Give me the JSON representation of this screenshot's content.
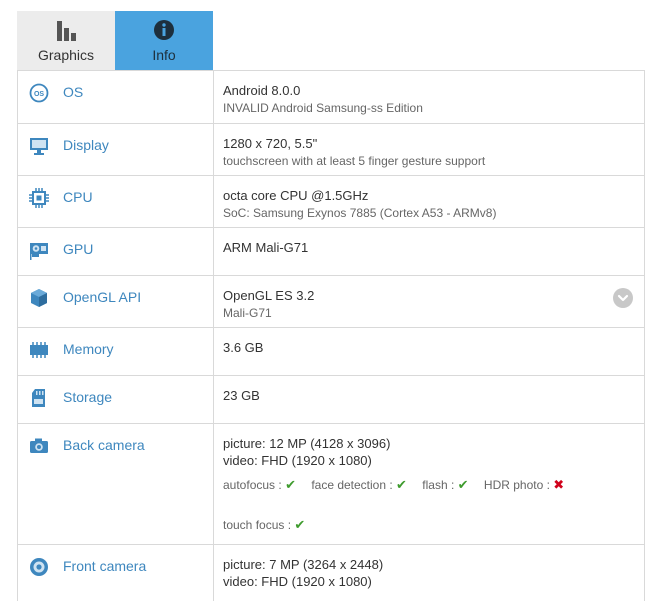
{
  "tabs": [
    {
      "label": "Graphics",
      "icon": "bar-chart-icon"
    },
    {
      "label": "Info",
      "icon": "info-icon"
    }
  ],
  "rows": {
    "os": {
      "label": "OS",
      "main": "Android 8.0.0",
      "sub": "INVALID Android Samsung-ss Edition"
    },
    "display": {
      "label": "Display",
      "main": "1280 x 720, 5.5\"",
      "sub": "touchscreen with at least 5 finger gesture support"
    },
    "cpu": {
      "label": "CPU",
      "main": "octa core CPU @1.5GHz",
      "sub": "SoC: Samsung Exynos 7885 (Cortex A53 - ARMv8)"
    },
    "gpu": {
      "label": "GPU",
      "main": "ARM Mali-G71"
    },
    "opengl": {
      "label": "OpenGL API",
      "main": "OpenGL ES 3.2",
      "sub": "Mali-G71"
    },
    "memory": {
      "label": "Memory",
      "main": "3.6 GB"
    },
    "storage": {
      "label": "Storage",
      "main": "23 GB"
    },
    "back_camera": {
      "label": "Back camera",
      "picture": "picture: 12 MP (4128 x 3096)",
      "video": "video: FHD (1920 x 1080)",
      "features": [
        {
          "label": "autofocus :",
          "supported": true
        },
        {
          "label": "face detection :",
          "supported": true
        },
        {
          "label": "flash :",
          "supported": true
        },
        {
          "label": "HDR photo :",
          "supported": false
        },
        {
          "label": "touch focus :",
          "supported": true
        }
      ]
    },
    "front_camera": {
      "label": "Front camera",
      "picture": "picture: 7 MP (3264 x 2448)",
      "video": "video: FHD (1920 x 1080)"
    }
  },
  "symbols": {
    "check": "✔",
    "cross": "✖"
  },
  "colors": {
    "accent": "#4aa3df",
    "label_blue": "#3e87be",
    "check_green": "#3e9b2d",
    "cross_red": "#d0021b"
  }
}
